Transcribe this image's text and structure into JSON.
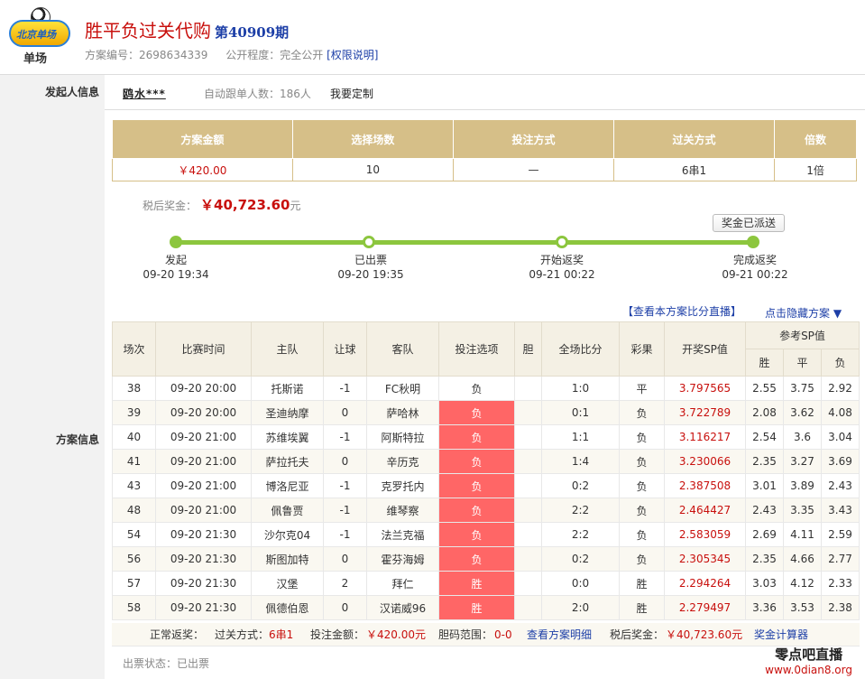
{
  "header": {
    "logo_text": "单场",
    "logo_badge": "北京单场",
    "title": "胜平负过关代购",
    "issue": "第40909期",
    "plan_no_label": "方案编号：",
    "plan_no": "2698634339",
    "public_label": "公开程度：",
    "public_value": "完全公开",
    "permission_link": "[权限说明]"
  },
  "sponsor": {
    "label": "发起人信息",
    "name": "鸥水***",
    "follow_label": "自动跟单人数：",
    "follow_count": "186人",
    "custom": "我要定制"
  },
  "plan_label": "方案信息",
  "summary": {
    "headers": [
      "方案金额",
      "选择场数",
      "投注方式",
      "过关方式",
      "倍数"
    ],
    "values": [
      "￥420.00",
      "10",
      "—",
      "6串1",
      "1倍"
    ]
  },
  "prize": {
    "label": "税后奖金：",
    "amount": "￥40,723.60",
    "unit": "元",
    "status_button": "奖金已派送"
  },
  "progress": [
    {
      "label": "发起",
      "time": "09-20 19:34"
    },
    {
      "label": "已出票",
      "time": "09-20 19:35"
    },
    {
      "label": "开始返奖",
      "time": "09-21 00:22"
    },
    {
      "label": "完成返奖",
      "time": "09-21 00:22"
    }
  ],
  "links": {
    "score_live": "【查看本方案比分直播】",
    "hide_plan": "点击隐藏方案 ▼"
  },
  "table": {
    "headers": [
      "场次",
      "比赛时间",
      "主队",
      "让球",
      "客队",
      "投注选项",
      "胆",
      "全场比分",
      "彩果",
      "开奖SP值",
      "参考SP值"
    ],
    "sp_sub": [
      "胜",
      "平",
      "负"
    ],
    "rows": [
      [
        "38",
        "09-20 20:00",
        "托斯诺",
        "-1",
        "FC秋明",
        "负",
        "",
        "1:0",
        "平",
        "3.797565",
        "2.55",
        "3.75",
        "2.92"
      ],
      [
        "39",
        "09-20 20:00",
        "圣迪纳摩",
        "0",
        "萨哈林",
        "负",
        "",
        "0:1",
        "负",
        "3.722789",
        "2.08",
        "3.62",
        "4.08"
      ],
      [
        "40",
        "09-20 21:00",
        "苏维埃翼",
        "-1",
        "阿斯特拉",
        "负",
        "",
        "1:1",
        "负",
        "3.116217",
        "2.54",
        "3.6",
        "3.04"
      ],
      [
        "41",
        "09-20 21:00",
        "萨拉托夫",
        "0",
        "辛历克",
        "负",
        "",
        "1:4",
        "负",
        "3.230066",
        "2.35",
        "3.27",
        "3.69"
      ],
      [
        "43",
        "09-20 21:00",
        "博洛尼亚",
        "-1",
        "克罗托内",
        "负",
        "",
        "0:2",
        "负",
        "2.387508",
        "3.01",
        "3.89",
        "2.43"
      ],
      [
        "48",
        "09-20 21:00",
        "佩鲁贾",
        "-1",
        "维琴察",
        "负",
        "",
        "2:2",
        "负",
        "2.464427",
        "2.43",
        "3.35",
        "3.43"
      ],
      [
        "54",
        "09-20 21:30",
        "沙尔克04",
        "-1",
        "法兰克福",
        "负",
        "",
        "2:2",
        "负",
        "2.583059",
        "2.69",
        "4.11",
        "2.59"
      ],
      [
        "56",
        "09-20 21:30",
        "斯图加特",
        "0",
        "霍芬海姆",
        "负",
        "",
        "0:2",
        "负",
        "2.305345",
        "2.35",
        "4.66",
        "2.77"
      ],
      [
        "57",
        "09-20 21:30",
        "汉堡",
        "2",
        "拜仁",
        "胜",
        "",
        "0:0",
        "胜",
        "2.294264",
        "3.03",
        "4.12",
        "2.33"
      ],
      [
        "58",
        "09-20 21:30",
        "佩德伯恩",
        "0",
        "汉诺威96",
        "胜",
        "",
        "2:0",
        "胜",
        "2.279497",
        "3.36",
        "3.53",
        "2.38"
      ]
    ],
    "highlight_rows": [
      1,
      2,
      3,
      4,
      5,
      6,
      7,
      8,
      9
    ]
  },
  "footer": {
    "normal": "正常返奖：",
    "pass_label": "过关方式：",
    "pass_value": "6串1",
    "bet_label": "投注金额：",
    "bet_value": "￥420.00元",
    "banker_label": "胆码范围：",
    "banker_value": "0-0",
    "detail_link": "查看方案明细",
    "tax_label": "税后奖金：",
    "tax_value": "￥40,723.60元",
    "calc_link": "奖金计算器"
  },
  "ticket": {
    "label": "出票状态：",
    "value": "已出票"
  },
  "watermark": {
    "line1": "零点吧直播",
    "line2": "www.0dian8.org"
  },
  "colors": {
    "accent": "#c8100d",
    "gold": "#d6bf88",
    "green": "#8cc63e",
    "pick": "#ff6666",
    "link": "#1d3fa7"
  }
}
